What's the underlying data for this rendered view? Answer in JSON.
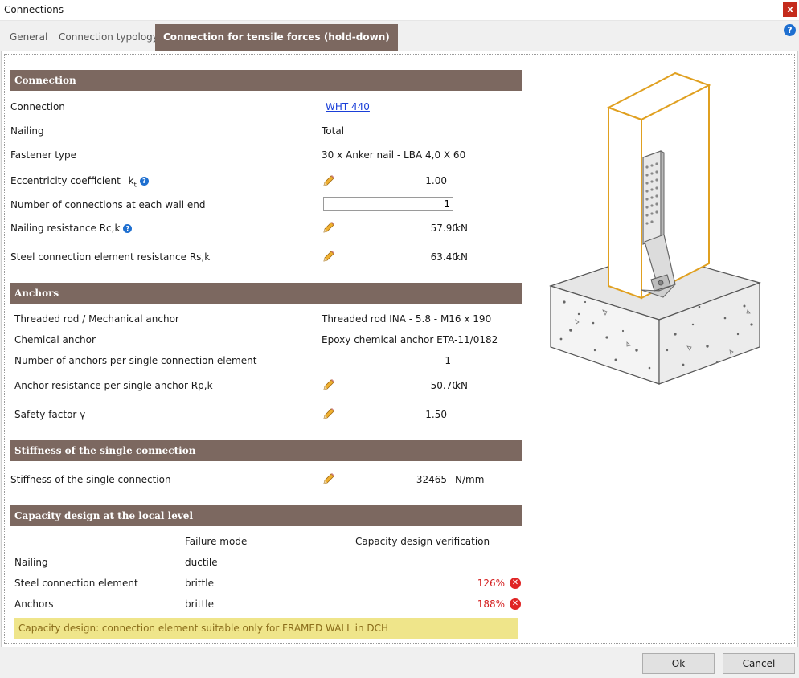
{
  "window": {
    "title": "Connections",
    "close_label": "x"
  },
  "tabs": [
    {
      "label": "General"
    },
    {
      "label": "Connection typology"
    },
    {
      "label": "Connection for tensile forces (hold-down)"
    }
  ],
  "help_label": "?",
  "sections": {
    "connection": "Connection",
    "anchors": "Anchors",
    "stiffness": "Stiffness of the single connection",
    "capacity": "Capacity design at the local level"
  },
  "connection": {
    "connection_label": "Connection",
    "connection_value": "WHT 440",
    "nailing_label": "Nailing",
    "nailing_value": "Total",
    "fastener_label": "Fastener type",
    "fastener_value": "30 x Anker nail - LBA 4,0 X 60",
    "eccentricity_label": "Eccentricity coefficient",
    "eccentricity_symbol": "k",
    "eccentricity_sub": "t",
    "eccentricity_value": "1.00",
    "num_connections_label": "Number of connections at each wall end",
    "num_connections_value": "1",
    "nailing_resistance_label": "Nailing resistance Rc,k",
    "nailing_resistance_value": "57.90",
    "nailing_resistance_unit": "kN",
    "steel_resistance_label": "Steel connection element resistance Rs,k",
    "steel_resistance_value": "63.40",
    "steel_resistance_unit": "kN"
  },
  "anchors": {
    "rod_label": "Threaded rod / Mechanical anchor",
    "rod_value": "Threaded rod INA - 5.8 - M16 x 190",
    "chemical_label": "Chemical anchor",
    "chemical_value": "Epoxy chemical anchor ETA-11/0182",
    "count_label": "Number of anchors per single connection element",
    "count_value": "1",
    "resistance_label": "Anchor resistance per single anchor Rp,k",
    "resistance_value": "50.70",
    "resistance_unit": "kN",
    "safety_label": "Safety factor γ",
    "safety_value": "1.50"
  },
  "stiffness": {
    "label": "Stiffness of the single connection",
    "value": "32465",
    "unit": "N/mm"
  },
  "capacity": {
    "col_failure": "Failure mode",
    "col_verification": "Capacity design verification",
    "rows": [
      {
        "name": "Nailing",
        "mode": "ductile",
        "pct": ""
      },
      {
        "name": "Steel connection element",
        "mode": "brittle",
        "pct": "126%"
      },
      {
        "name": "Anchors",
        "mode": "brittle",
        "pct": "188%"
      }
    ],
    "warning": "Capacity design: connection element suitable only for FRAMED WALL in DCH"
  },
  "buttons": {
    "ok": "Ok",
    "cancel": "Cancel"
  },
  "colors": {
    "section_bg": "#7c6860",
    "error": "#e02424",
    "warning_bg": "#efe58a",
    "wall_outline": "#e0a020"
  }
}
